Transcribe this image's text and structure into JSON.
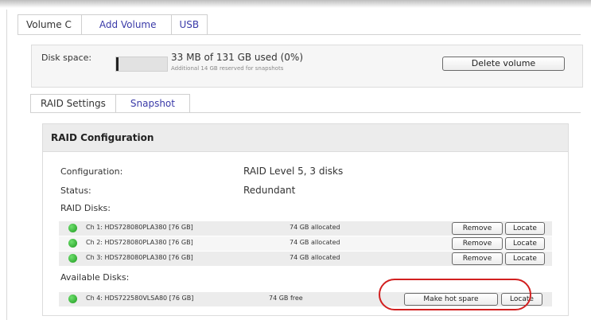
{
  "volume_tabs": [
    {
      "label": "Volume C"
    },
    {
      "label": "Add Volume"
    },
    {
      "label": "USB"
    }
  ],
  "disk_space": {
    "label": "Disk space:",
    "used_fraction": 0.0,
    "summary": "33 MB of 131 GB used (0%)",
    "reserved_note": "Additional 14 GB reserved for snapshots",
    "delete_button": "Delete volume"
  },
  "sub_tabs": [
    {
      "label": "RAID Settings"
    },
    {
      "label": "Snapshot"
    }
  ],
  "raid": {
    "title": "RAID Configuration",
    "configuration_label": "Configuration:",
    "configuration_value": "RAID Level 5, 3 disks",
    "status_label": "Status:",
    "status_value": "Redundant",
    "raid_disks_label": "RAID Disks:",
    "raid_disks": [
      {
        "name": "Ch 1: HDS728080PLA380 [76 GB]",
        "allocation": "74 GB allocated",
        "remove": "Remove",
        "locate": "Locate"
      },
      {
        "name": "Ch 2: HDS728080PLA380 [76 GB]",
        "allocation": "74 GB allocated",
        "remove": "Remove",
        "locate": "Locate"
      },
      {
        "name": "Ch 3: HDS728080PLA380 [76 GB]",
        "allocation": "74 GB allocated",
        "remove": "Remove",
        "locate": "Locate"
      }
    ],
    "available_label": "Available Disks:",
    "available_disks": [
      {
        "name": "Ch 4: HDS722580VLSA80 [76 GB]",
        "free": "74 GB free",
        "hot_spare": "Make hot spare",
        "locate": "Locate"
      }
    ]
  },
  "colors": {
    "link": "#3a3aa8",
    "status_ok": "#2db82d",
    "highlight": "#d22020"
  }
}
